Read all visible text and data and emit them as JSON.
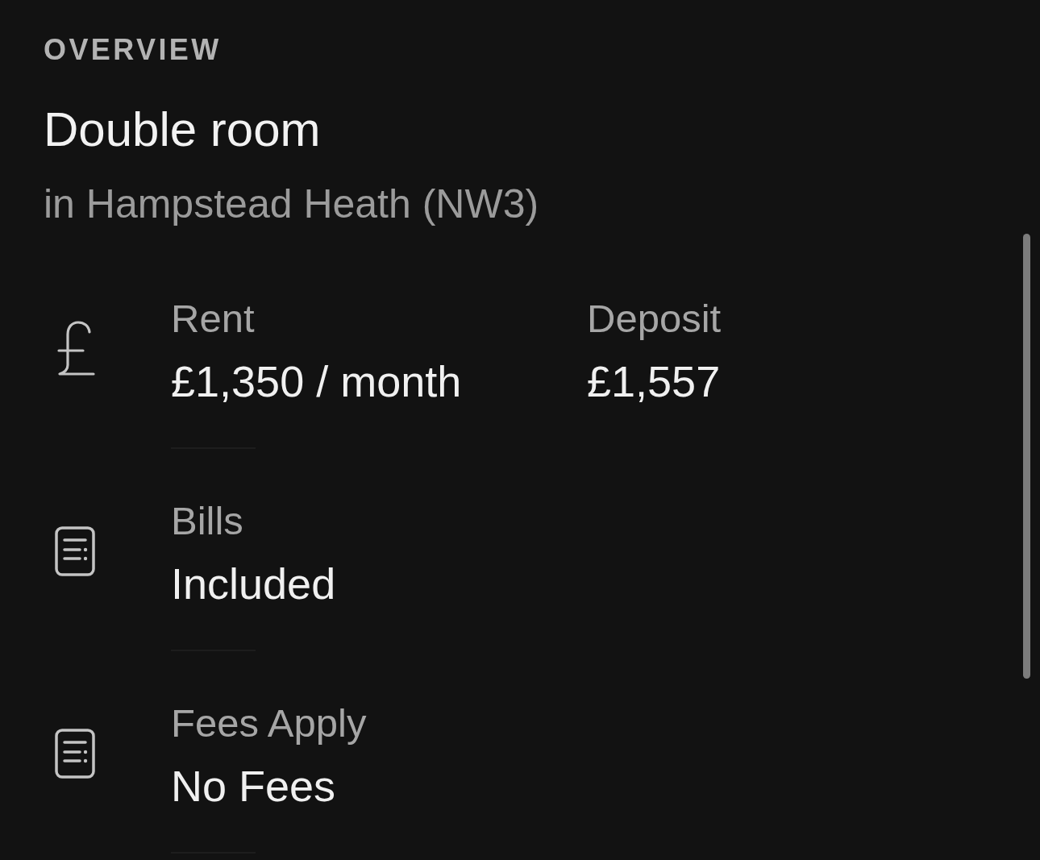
{
  "section_title": "OVERVIEW",
  "title": "Double room",
  "subtitle": "in Hampstead Heath (NW3)",
  "rows": [
    {
      "kind": "currency",
      "items": [
        {
          "label": "Rent",
          "value": "£1,350 / month"
        },
        {
          "label": "Deposit",
          "value": "£1,557"
        }
      ]
    },
    {
      "kind": "document",
      "items": [
        {
          "label": "Bills",
          "value": "Included"
        }
      ]
    },
    {
      "kind": "document",
      "items": [
        {
          "label": "Fees Apply",
          "value": "No Fees"
        }
      ]
    }
  ]
}
